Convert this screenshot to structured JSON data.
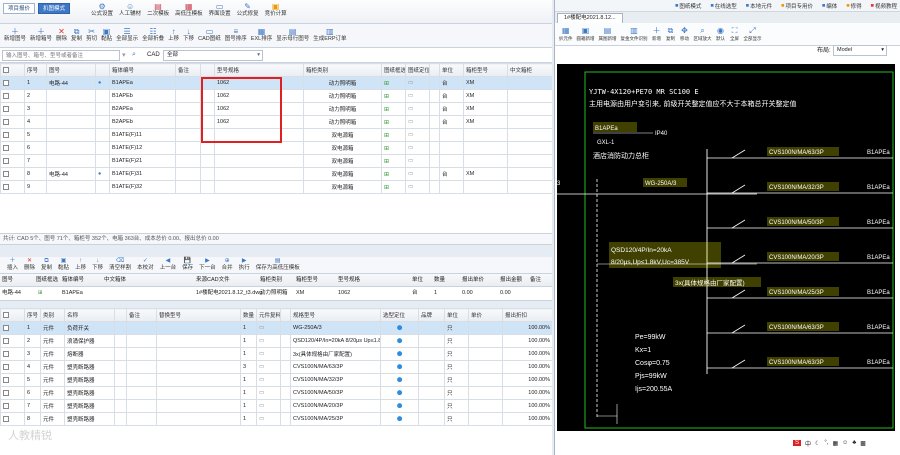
{
  "top": {
    "tab1": "项目报价",
    "tab2": "扒图模式",
    "buttons": [
      "公式设置",
      "人工辅材",
      "二次模板",
      "高低压模板",
      "界面设置",
      "公式修复",
      "竞价计算"
    ]
  },
  "toolbar": [
    "新增图号",
    "新增箱号",
    "删除",
    "复制",
    "剪切",
    "黏贴",
    "全部显示",
    "全部折叠",
    "上移",
    "下移",
    "CAD图纸",
    "图号排序",
    "EXL排序",
    "显示母行图号",
    "生成ERP订单"
  ],
  "filter": {
    "placeholder": "输入图号、箱号、型号或者备注",
    "cad_label": "CAD",
    "cad_value": "全部"
  },
  "grid": {
    "columns": [
      "",
      "序号",
      "图号",
      "",
      "箱体编号",
      "备注",
      "",
      "型号规格",
      "箱柜类别",
      "图纸框选",
      "图纸定位",
      "",
      "单位",
      "箱柜型号",
      "中文箱柜"
    ],
    "rows": [
      {
        "no": "1",
        "fig": "电路-44",
        "box": "B1APEa",
        "model": "1062",
        "cat": "动力照明箱",
        "unit": "台",
        "m": "XM",
        "sel": true
      },
      {
        "no": "2",
        "fig": "",
        "box": "B1APEb",
        "model": "1062",
        "cat": "动力照明箱",
        "unit": "台",
        "m": "XM",
        "sel": false
      },
      {
        "no": "3",
        "fig": "",
        "box": "B2APEa",
        "model": "1062",
        "cat": "动力照明箱",
        "unit": "台",
        "m": "XM",
        "sel": false
      },
      {
        "no": "4",
        "fig": "",
        "box": "B2APEb",
        "model": "1062",
        "cat": "动力照明箱",
        "unit": "台",
        "m": "XM",
        "sel": false
      },
      {
        "no": "5",
        "fig": "",
        "box": "B1ATE(F)11",
        "model": "",
        "cat": "双电源箱",
        "unit": "",
        "m": "",
        "sel": false
      },
      {
        "no": "6",
        "fig": "",
        "box": "B1ATE(F)12",
        "model": "",
        "cat": "双电源箱",
        "unit": "",
        "m": "",
        "sel": false
      },
      {
        "no": "7",
        "fig": "",
        "box": "B1ATE(F)21",
        "model": "",
        "cat": "双电源箱",
        "unit": "",
        "m": "",
        "sel": false
      },
      {
        "no": "8",
        "fig": "电路-44",
        "box": "B1ATE(F)31",
        "model": "",
        "cat": "双电源箱",
        "unit": "台",
        "m": "XM",
        "sel": false
      },
      {
        "no": "9",
        "fig": "",
        "box": "B1ATE(F)32",
        "model": "",
        "cat": "双电源箱",
        "unit": "",
        "m": "",
        "sel": false
      }
    ]
  },
  "status": "共计: CAD 5个、图号 71个、箱柜号 352个、电箱 363台、成本总价 0.00、报出总价 0.00",
  "toolbar2": [
    "插入",
    "删除",
    "复制",
    "黏贴",
    "上移",
    "下移",
    "清空样割",
    "本校对",
    "上一台",
    "保存",
    "下一台",
    "合并",
    "执行",
    "保存为高低压模板"
  ],
  "detailhdr": [
    "图号",
    "图纸框选",
    "箱体编号",
    "中文箱体",
    "来源CAD文件",
    "箱柜类别",
    "箱柜型号",
    "型号规格",
    "单位",
    "数量",
    "报出单价",
    "报出金额",
    "备注"
  ],
  "detail": {
    "fig": "电路-44",
    "box": "B1APEa",
    "cad": "1#楼配电2021.8.12_t3.dwg",
    "cat": "动力照明箱",
    "m": "XM",
    "model": "1062",
    "unit": "台",
    "qty": "1",
    "price": "0.00",
    "amt": "0.00"
  },
  "cgrid": {
    "columns": [
      "",
      "序号",
      "类别",
      "名称",
      "",
      "备注",
      "替换型号",
      "数量",
      "元件复料",
      "",
      "规格型号",
      "选型定位",
      "品牌",
      "单位",
      "单价",
      "报出折扣"
    ],
    "rows": [
      {
        "no": "1",
        "t": "元件",
        "n": "负荷开关",
        "qty": "1",
        "spec": "WG-250A/3",
        "u": "只",
        "d": "100.00%",
        "sel": true
      },
      {
        "no": "2",
        "t": "元件",
        "n": "浪涌保护器",
        "qty": "1",
        "spec": "QSD120/4P/In=20kA 8/20μs Up≤1.8kV",
        "u": "只",
        "d": "100.00%",
        "sel": false
      },
      {
        "no": "3",
        "t": "元件",
        "n": "熔断器",
        "qty": "1",
        "spec": "3x(具体规格由厂家配置)",
        "u": "只",
        "d": "100.00%",
        "sel": false
      },
      {
        "no": "4",
        "t": "元件",
        "n": "塑壳断路器",
        "qty": "3",
        "spec": "CVS100N/MA/63/3P",
        "u": "只",
        "d": "100.00%",
        "sel": false
      },
      {
        "no": "5",
        "t": "元件",
        "n": "塑壳断路器",
        "qty": "1",
        "spec": "CVS100N/MA/32/3P",
        "u": "只",
        "d": "100.00%",
        "sel": false
      },
      {
        "no": "6",
        "t": "元件",
        "n": "塑壳断路器",
        "qty": "1",
        "spec": "CVS100N/MA/50/3P",
        "u": "只",
        "d": "100.00%",
        "sel": false
      },
      {
        "no": "7",
        "t": "元件",
        "n": "塑壳断路器",
        "qty": "1",
        "spec": "CVS100N/MA/20/3P",
        "u": "只",
        "d": "100.00%",
        "sel": false
      },
      {
        "no": "8",
        "t": "元件",
        "n": "塑壳断路器",
        "qty": "1",
        "spec": "CVS100N/MA/25/3P",
        "u": "只",
        "d": "100.00%",
        "sel": false
      }
    ]
  },
  "right": {
    "buttons": [
      "图纸模式",
      "在线选型",
      "本地元件",
      "项目专用价",
      "编体",
      "修得",
      "视频教程"
    ],
    "tab": "1#楼配电2021.8.12...",
    "cadtools": [
      "扒元件",
      "圆箱新增",
      "属图新增",
      "复金文件识别",
      "新增",
      "复制",
      "移动",
      "区域放大",
      "默认",
      "全屏",
      "全部显示"
    ],
    "layout_label": "布局:",
    "layout_value": "Model"
  },
  "cad": {
    "line1": "YJTW-4X120+PE70 MR SC100 E",
    "line2": "主用电源由用户变引来, 前级开关整定值应不大于本箱总开关整定值",
    "box": "B1APEa",
    "ip": "IP40",
    "gxl": "GXL-1",
    "shop": "酒店消防动力总柜",
    "sw": "WG-250A/3",
    "spd1": "QSD120/4P/In=20kA",
    "spd2": "8/20μs,Up≤1.8kV,Uc=385V",
    "fuse": "3x(具体规格由厂家配置)",
    "pe": "Pe=99kW",
    "kx": "Kx=1",
    "cos": "Cosφ=0.75",
    "pjs": "Pjs=99kW",
    "ijs": "Ijs=200.55A",
    "left3": "3",
    "brk": [
      "CVS100N/MA/63/3P",
      "CVS100N/MA/32/3P",
      "CVS100N/MA/50/3P",
      "CVS100N/MA/20/3P",
      "CVS100N/MA/25/3P",
      "CVS100N/MA/63/3P",
      "CVS100N/MA/63/3P"
    ],
    "out": "B1APEa"
  },
  "watermark": "人教精锐"
}
